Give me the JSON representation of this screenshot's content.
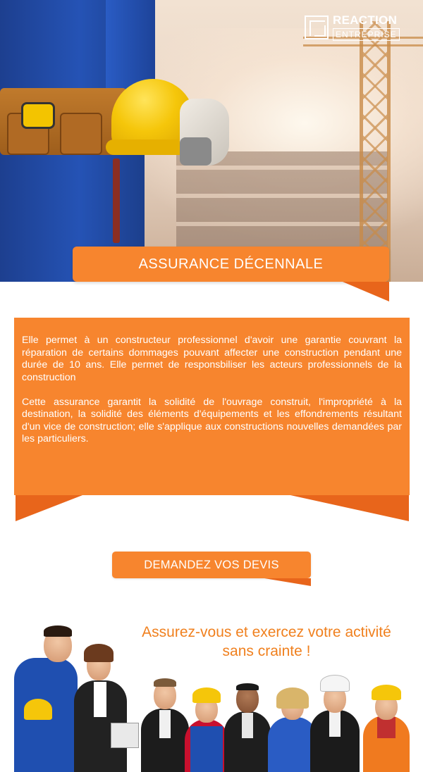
{
  "brand": {
    "name": "REACTION",
    "tagline": "ENTREPRISE"
  },
  "hero": {
    "title": "ASSURANCE DÉCENNALE"
  },
  "info": {
    "paragraph1": "Elle permet à un constructeur professionnel d'avoir une garantie couvrant la réparation de certains dommages pouvant affecter une construction pendant une durée de 10 ans. Elle permet de responsbiliser les acteurs professionnels de la construction",
    "paragraph2": "Cette assurance garantit la solidité de l'ouvrage construit, l'impropriété à la destination, la solidité des éléments d'équipements et les effondrements résultant d'un vice de construction; elle s'applique aux constructions nouvelles demandées par les particuliers."
  },
  "cta": {
    "label": "DEMANDEZ VOS DEVIS"
  },
  "slogan": {
    "line1": "Assurez-vous et exercez votre activité",
    "line2": "sans crainte !"
  },
  "colors": {
    "accent": "#f7852e",
    "accent_dark": "#e8651b",
    "slogan": "#f0801e",
    "text_on_accent": "#ffffff"
  }
}
